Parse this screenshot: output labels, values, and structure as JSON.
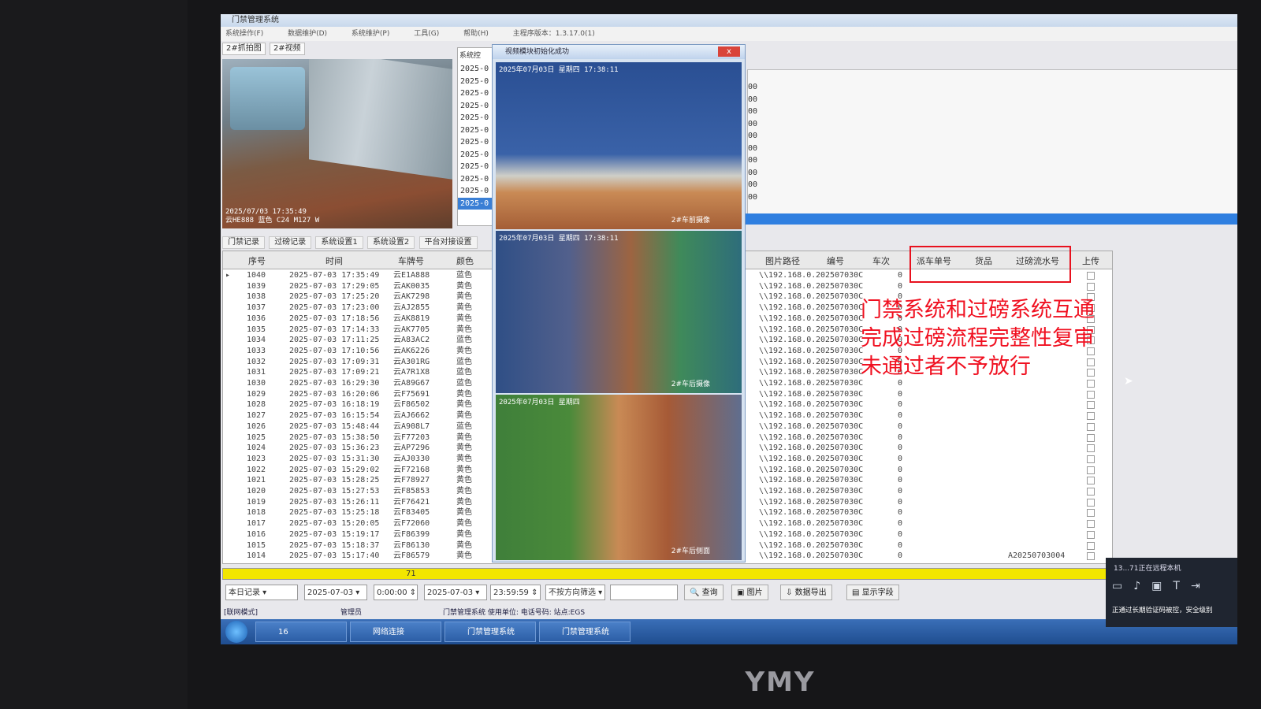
{
  "window": {
    "title": "门禁管理系统",
    "menu": [
      "系统操作(F)",
      "数据维护(D)",
      "系统维护(P)",
      "工具(G)",
      "帮助(H)",
      "主程序版本：1.3.17.0(1)"
    ]
  },
  "camera_tabs": [
    "2#抓拍图",
    "2#视频"
  ],
  "snapshot": {
    "timestamp": "2025/07/03 17:35:49",
    "plate_text": "云HE888 蓝色 C24 M127 W"
  },
  "side_list": {
    "header": "系统控",
    "items": [
      "2025-0",
      "2025-0",
      "2025-0",
      "2025-0",
      "2025-0",
      "2025-0",
      "2025-0",
      "2025-0",
      "2025-0",
      "2025-0",
      "2025-0",
      "2025-0"
    ]
  },
  "right_values": [
    "00",
    "00",
    "00",
    "00",
    "00",
    "00",
    "00",
    "00",
    "00",
    "00"
  ],
  "video_window": {
    "title": "视频模块初始化成功",
    "close": "x",
    "cam1_ts": "2025年07月03日 星期四 17:38:11",
    "cam1_label": "2#车前摄像",
    "cam2_ts": "2025年07月03日 星期四 17:38:11",
    "cam2_label": "2#车后摄像",
    "cam3_ts": "2025年07月03日 星期四",
    "cam3_label": "2#车后侧面"
  },
  "record_tabs": [
    "门禁记录",
    "过磅记录",
    "系统设置1",
    "系统设置2",
    "平台对接设置"
  ],
  "table": {
    "headers_left": [
      "序号",
      "时间",
      "车牌号",
      "颜色"
    ],
    "headers_right": [
      "图片路径",
      "编号",
      "车次",
      "派车单号",
      "货品",
      "过磅流水号",
      "上传"
    ],
    "rows": [
      [
        "1040",
        "2025-07-03 17:35:49",
        "云E1A888",
        "蓝色",
        "0",
        ""
      ],
      [
        "1039",
        "2025-07-03 17:29:05",
        "云AK0035",
        "黄色",
        "0",
        ""
      ],
      [
        "1038",
        "2025-07-03 17:25:20",
        "云AK7298",
        "黄色",
        "0",
        ""
      ],
      [
        "1037",
        "2025-07-03 17:23:00",
        "云AJ2855",
        "黄色",
        "0",
        ""
      ],
      [
        "1036",
        "2025-07-03 17:18:56",
        "云AK8819",
        "黄色",
        "0",
        ""
      ],
      [
        "1035",
        "2025-07-03 17:14:33",
        "云AK7705",
        "黄色",
        "0",
        ""
      ],
      [
        "1034",
        "2025-07-03 17:11:25",
        "云A83AC2",
        "蓝色",
        "0",
        ""
      ],
      [
        "1033",
        "2025-07-03 17:10:56",
        "云AK6226",
        "黄色",
        "0",
        ""
      ],
      [
        "1032",
        "2025-07-03 17:09:31",
        "云A301RG",
        "蓝色",
        "0",
        ""
      ],
      [
        "1031",
        "2025-07-03 17:09:21",
        "云A7R1X8",
        "蓝色",
        "0",
        ""
      ],
      [
        "1030",
        "2025-07-03 16:29:30",
        "云A89G67",
        "蓝色",
        "0",
        ""
      ],
      [
        "1029",
        "2025-07-03 16:20:06",
        "云F75691",
        "黄色",
        "0",
        ""
      ],
      [
        "1028",
        "2025-07-03 16:18:19",
        "云F86502",
        "黄色",
        "0",
        ""
      ],
      [
        "1027",
        "2025-07-03 16:15:54",
        "云AJ6662",
        "黄色",
        "0",
        ""
      ],
      [
        "1026",
        "2025-07-03 15:48:44",
        "云A908L7",
        "蓝色",
        "0",
        ""
      ],
      [
        "1025",
        "2025-07-03 15:38:50",
        "云F77203",
        "黄色",
        "0",
        ""
      ],
      [
        "1024",
        "2025-07-03 15:36:23",
        "云AP7296",
        "黄色",
        "0",
        ""
      ],
      [
        "1023",
        "2025-07-03 15:31:30",
        "云AJ0330",
        "黄色",
        "0",
        ""
      ],
      [
        "1022",
        "2025-07-03 15:29:02",
        "云F72168",
        "黄色",
        "0",
        ""
      ],
      [
        "1021",
        "2025-07-03 15:28:25",
        "云F78927",
        "黄色",
        "0",
        ""
      ],
      [
        "1020",
        "2025-07-03 15:27:53",
        "云F85853",
        "黄色",
        "0",
        ""
      ],
      [
        "1019",
        "2025-07-03 15:26:11",
        "云F76421",
        "黄色",
        "0",
        ""
      ],
      [
        "1018",
        "2025-07-03 15:25:18",
        "云F83405",
        "黄色",
        "0",
        ""
      ],
      [
        "1017",
        "2025-07-03 15:20:05",
        "云F72060",
        "黄色",
        "0",
        ""
      ],
      [
        "1016",
        "2025-07-03 15:19:17",
        "云F86399",
        "黄色",
        "0",
        ""
      ],
      [
        "1015",
        "2025-07-03 15:18:37",
        "云F86130",
        "黄色",
        "0",
        ""
      ],
      [
        "1014",
        "2025-07-03 15:17:40",
        "云F86579",
        "黄色",
        "0",
        "A20250703004"
      ]
    ],
    "path_text": "\\\\192.168.0.",
    "code_text": "202507030C",
    "total": "71"
  },
  "annotation": {
    "lines": [
      "门禁系统和过磅系统互通",
      "完成过磅流程完整性复审",
      "未通过者不予放行"
    ],
    "color": "#f01020"
  },
  "toolbar": {
    "range": "本日记录",
    "date_from": "2025-07-03",
    "time_from": "0:00:00",
    "date_to": "2025-07-03",
    "time_to": "23:59:59",
    "direction": "不按方向筛选",
    "search_placeholder": "",
    "btn_query": "查询",
    "btn_image": "图片",
    "btn_export": "数据导出",
    "btn_fields": "显示字段"
  },
  "statusline": {
    "mode": "[联网模式]",
    "user": "管理员",
    "info": "门禁管理系统 使用单位: 电话号码: 站点:EGS"
  },
  "taskbar": {
    "items": [
      "16",
      "网络连接",
      "门禁管理系统",
      "门禁管理系统"
    ]
  },
  "remote_panel": {
    "title": "13...71正在远程本机",
    "bottom": "正通过长期验证码被控，安全级别"
  },
  "monitor_brand": "YMY"
}
